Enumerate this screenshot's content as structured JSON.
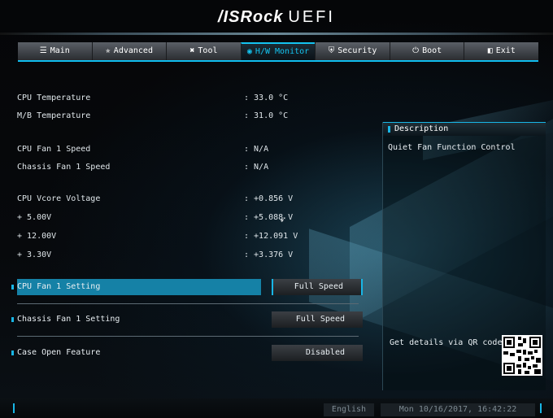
{
  "header": {
    "brand": "/ISRock",
    "product": "UEFI"
  },
  "tabs": [
    {
      "label": "Main",
      "icon": "list-icon"
    },
    {
      "label": "Advanced",
      "icon": "star-icon"
    },
    {
      "label": "Tool",
      "icon": "tools-icon"
    },
    {
      "label": "H/W Monitor",
      "icon": "globe-icon",
      "active": true
    },
    {
      "label": "Security",
      "icon": "shield-icon"
    },
    {
      "label": "Boot",
      "icon": "power-icon"
    },
    {
      "label": "Exit",
      "icon": "exit-icon"
    }
  ],
  "monitor": [
    {
      "label": "CPU Temperature",
      "value": ": 33.0 °C"
    },
    {
      "label": "M/B Temperature",
      "value": ": 31.0 °C"
    },
    {
      "label": "CPU Fan 1 Speed",
      "value": ": N/A"
    },
    {
      "label": "Chassis Fan 1 Speed",
      "value": ": N/A"
    },
    {
      "label": "CPU Vcore Voltage",
      "value": ": +0.856 V"
    },
    {
      "label": "+ 5.00V",
      "value": ": +5.088 V"
    },
    {
      "label": "+ 12.00V",
      "value": ": +12.091 V"
    },
    {
      "label": "+ 3.30V",
      "value": ": +3.376 V"
    }
  ],
  "settings": [
    {
      "label": "CPU Fan 1 Setting",
      "value": "Full Speed"
    },
    {
      "label": "Chassis Fan 1 Setting",
      "value": "Full Speed"
    },
    {
      "label": "Case Open Feature",
      "value": "Disabled"
    }
  ],
  "description": {
    "title": "Description",
    "text": "Quiet Fan Function Control",
    "qr_label": "Get details via QR code"
  },
  "footer": {
    "language": "English",
    "datetime": "Mon 10/16/2017, 16:42:22"
  },
  "colors": {
    "accent": "#18b6e6",
    "selection": "#1581a6"
  }
}
